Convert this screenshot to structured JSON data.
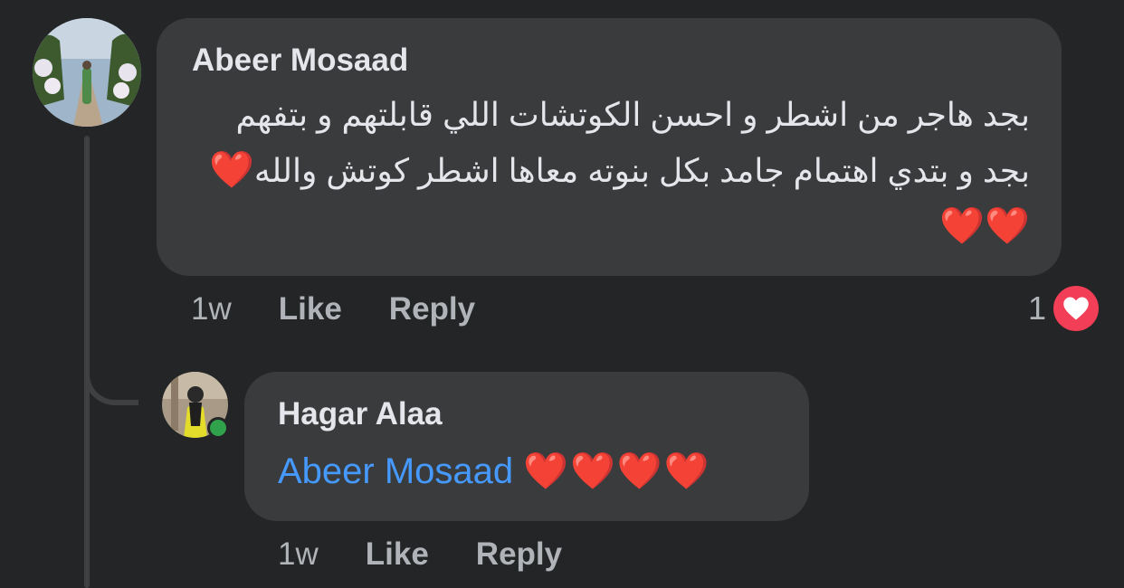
{
  "comment": {
    "author": "Abeer Mosaad",
    "text": "بجد هاجر من اشطر و احسن الكوتشات اللي قابلتهم و بتفهم بجد و بتدي اهتمام جامد بكل بنوته معاها اشطر كوتش والله",
    "hearts": "❤️❤️❤️",
    "time": "1w",
    "like_label": "Like",
    "reply_label": "Reply",
    "reaction": {
      "count": "1",
      "icon": "love-reaction-icon",
      "color": "#f33e58"
    }
  },
  "reply": {
    "author": "Hagar Alaa",
    "mention": "Abeer Mosaad",
    "hearts": "❤️❤️❤️❤️",
    "time": "1w",
    "like_label": "Like",
    "reply_label": "Reply",
    "online": true
  },
  "colors": {
    "background": "#242526",
    "bubble": "#3a3b3c",
    "text": "#e4e6eb",
    "secondary_text": "#b0b3b8",
    "mention": "#4599ff",
    "online": "#31a24c",
    "heart": "#e41e3f"
  }
}
